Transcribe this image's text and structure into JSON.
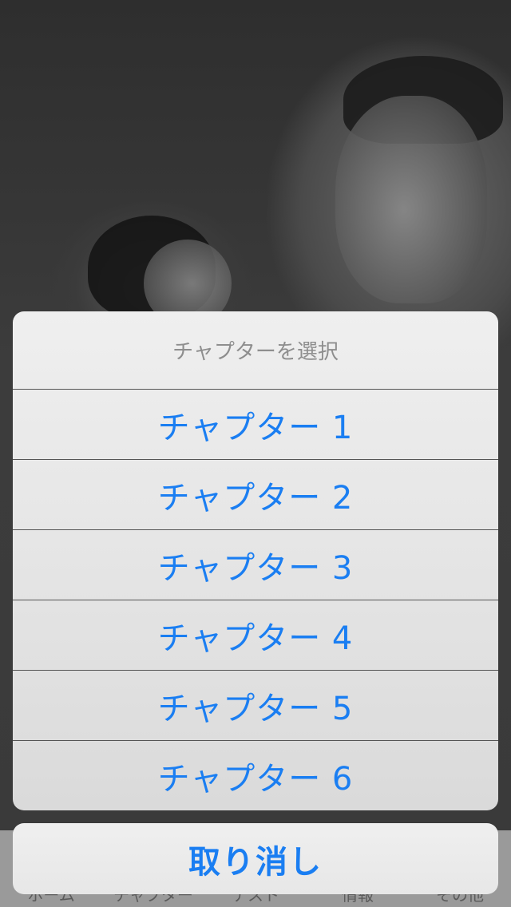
{
  "background": {
    "description": ""
  },
  "tabbar": {
    "items": [
      {
        "label": "ホーム",
        "icon": "home-icon"
      },
      {
        "label": "チャプター",
        "icon": "chapters-icon"
      },
      {
        "label": "テスト",
        "icon": "test-icon"
      },
      {
        "label": "情報",
        "icon": "info-icon"
      },
      {
        "label": "その他",
        "icon": "more-icon"
      }
    ]
  },
  "action_sheet": {
    "title": "チャプターを選択",
    "options": [
      {
        "label": "チャプター 1"
      },
      {
        "label": "チャプター 2"
      },
      {
        "label": "チャプター 3"
      },
      {
        "label": "チャプター 4"
      },
      {
        "label": "チャプター 5"
      },
      {
        "label": "チャプター 6"
      }
    ],
    "cancel_label": "取り消し"
  },
  "colors": {
    "action_blue": "#1a7ef2",
    "title_gray": "#8e8e8e",
    "sheet_bg": "#e6e6e6"
  }
}
